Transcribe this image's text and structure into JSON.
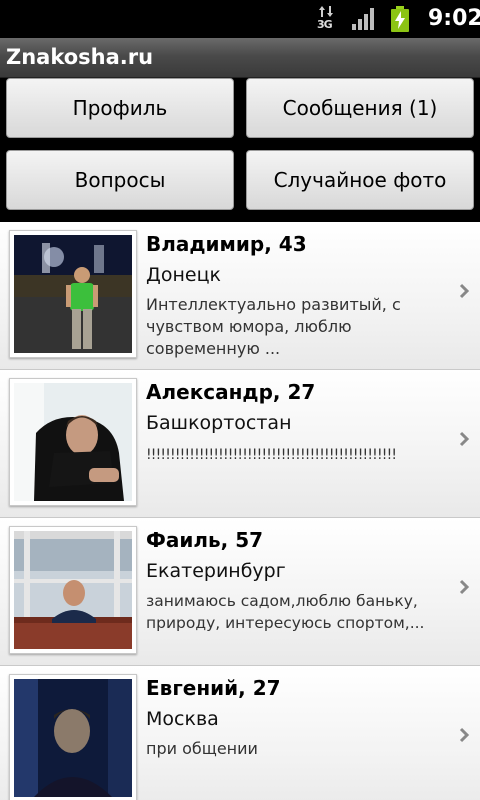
{
  "status_bar": {
    "network": "3G",
    "time": "9:02"
  },
  "app": {
    "title": "Znakosha.ru"
  },
  "buttons": {
    "profile": "Профиль",
    "messages": "Сообщения (1)",
    "questions": "Вопросы",
    "random_photo": "Случайное фото"
  },
  "profiles": [
    {
      "name": "Владимир, 43",
      "city": "Донецк",
      "description": "Интеллектуально развитый, с чувством юмора, люблю современную ...",
      "photo_icon": "person-photo"
    },
    {
      "name": "Александр, 27",
      "city": "Башкортостан",
      "description": "!!!!!!!!!!!!!!!!!!!!!!!!!!!!!!!!!!!!!!!!!!!!!!!!!!!!",
      "photo_icon": "person-photo"
    },
    {
      "name": "Фаиль, 57",
      "city": "Екатеринбург",
      "description": "занимаюсь садом,люблю баньку, природу, интересуюсь спортом,...",
      "photo_icon": "person-photo"
    },
    {
      "name": "Евгений, 27",
      "city": "Москва",
      "description": "при общении",
      "photo_icon": "person-photo"
    }
  ]
}
